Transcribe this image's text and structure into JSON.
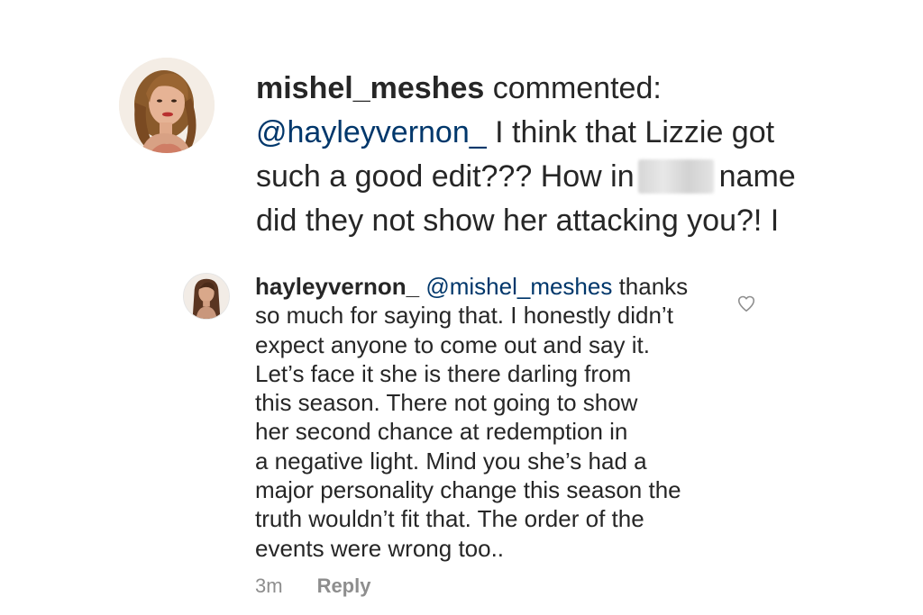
{
  "comment": {
    "username": "mishel_meshes",
    "action": " commented:",
    "mention": "@hayleyvernon_",
    "text_line1": " I think that Lizzie got",
    "text_line2_before": "such a good edit??? How in",
    "text_line2_after": "name",
    "text_line3": "did they not show her attacking you?! I"
  },
  "reply": {
    "username": "hayleyvernon_",
    "mention": "@mishel_meshes",
    "line1_after": " thanks",
    "lines": [
      "so much for saying that. I honestly didn’t",
      "expect anyone to come out and say it.",
      "Let’s face it she is there darling from",
      "this season. There not going to show",
      "her second chance at redemption in",
      "a negative light. Mind you she’s had a",
      "major personality change this season the",
      "truth wouldn’t fit that. The order of the",
      "events were wrong too.."
    ],
    "timestamp": "3m",
    "reply_label": "Reply",
    "like_icon": "heart-outline-icon"
  },
  "colors": {
    "text": "#262626",
    "mention": "#00376b",
    "muted": "#8e8e8e",
    "background": "#ffffff"
  }
}
